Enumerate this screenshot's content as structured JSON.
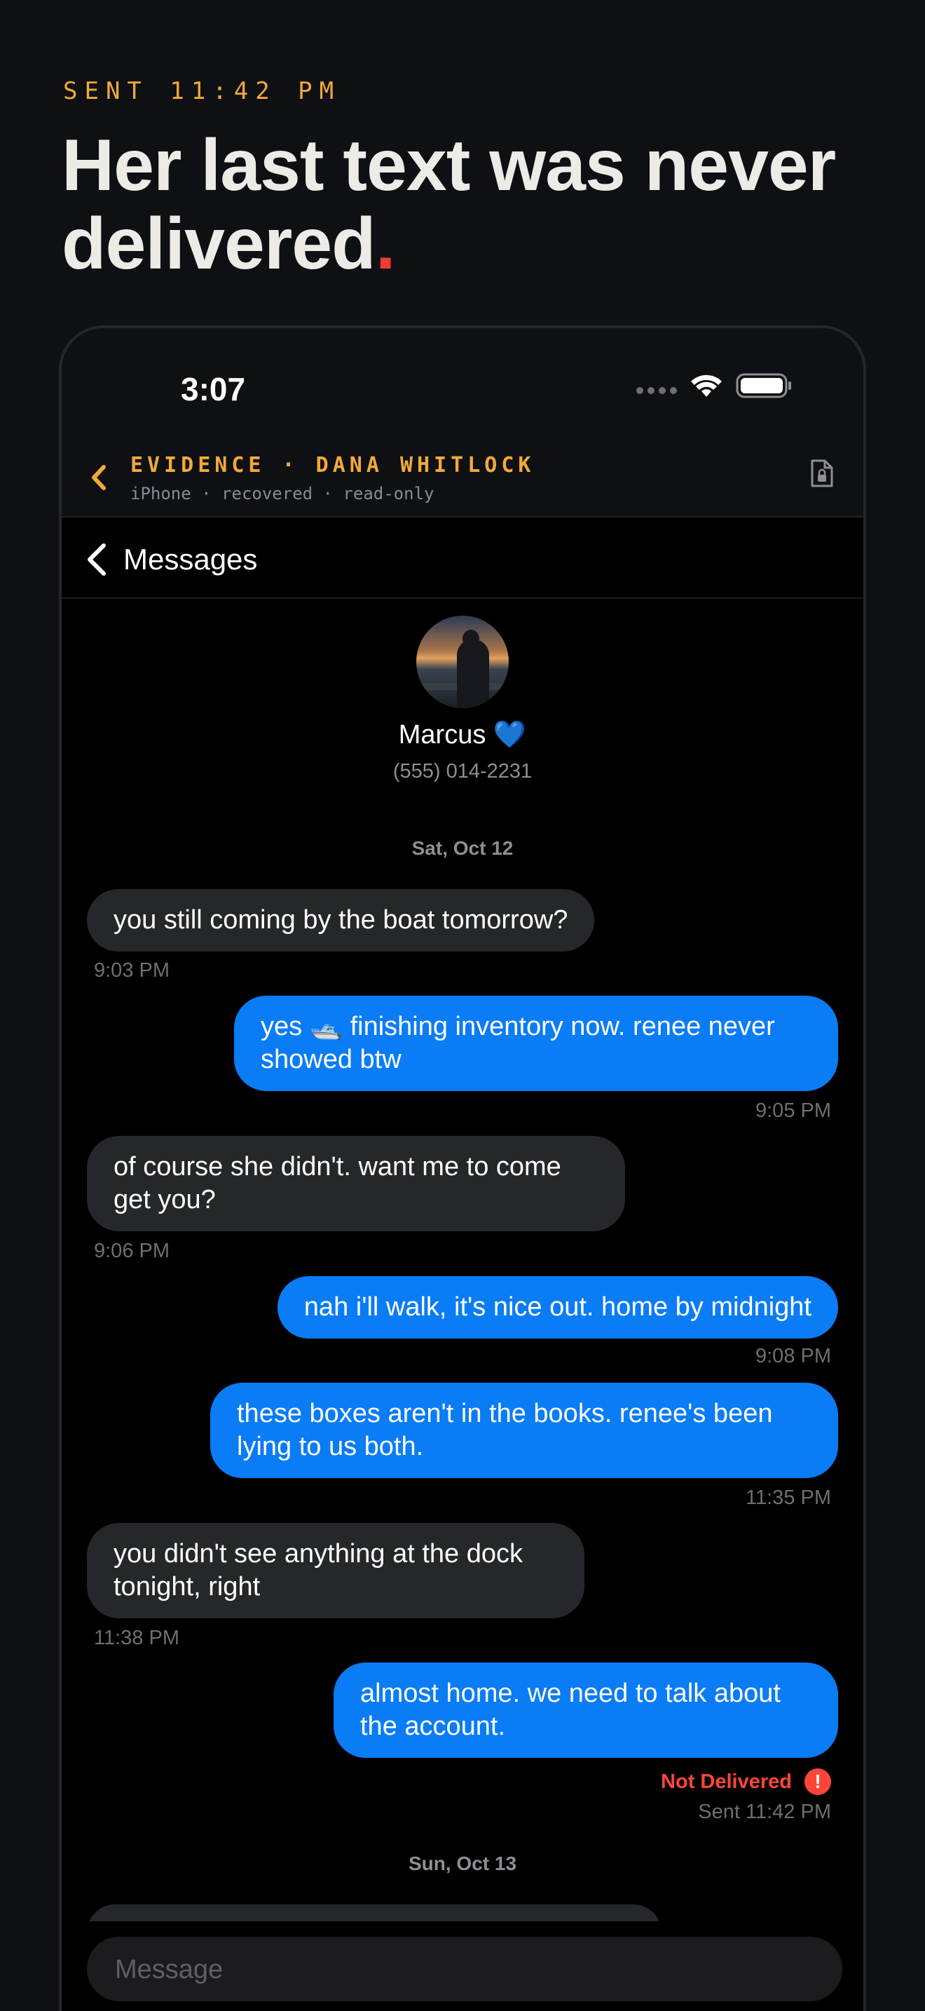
{
  "page": {
    "eyebrow": "SENT 11:42 PM",
    "headline": "Her last text was never delivered",
    "headline_dot": ".",
    "accent_color": "#f2a93b",
    "alert_color": "#ee3b34"
  },
  "status_bar": {
    "time": "3:07",
    "icons": [
      "cellular-signal-icon",
      "wifi-icon",
      "battery-icon"
    ]
  },
  "evidence_bar": {
    "back_icon": "chevron-left-icon",
    "title": "EVIDENCE · DANA WHITLOCK",
    "subtitle": "iPhone · recovered · read-only",
    "doc_icon": "locked-document-icon"
  },
  "nav": {
    "back_icon": "chevron-left-icon",
    "title": "Messages"
  },
  "contact": {
    "name": "Marcus 💙",
    "phone": "(555) 014-2231",
    "avatar_icon": "contact-photo"
  },
  "thread": {
    "date_1": "Sat, Oct 12",
    "messages": [
      {
        "direction": "in",
        "text": "you still coming by the boat tomorrow?",
        "time": "9:03 PM"
      },
      {
        "direction": "out",
        "text": "yes 🛥️ finishing inventory now. renee never showed btw",
        "time": "9:05 PM"
      },
      {
        "direction": "in",
        "text": "of course she didn't. want me to come get you?",
        "time": "9:06 PM"
      },
      {
        "direction": "out",
        "text": "nah i'll walk, it's nice out. home by midnight",
        "time": "9:08 PM"
      },
      {
        "direction": "out",
        "text": "these boxes aren't in the books. renee's been lying to us both.",
        "time": "11:35 PM"
      },
      {
        "direction": "in",
        "text": "you didn't see anything at the dock tonight, right",
        "time": "11:38 PM"
      },
      {
        "direction": "out",
        "text": "almost home. we need to talk about the account.",
        "time": "Sent 11:42 PM"
      }
    ],
    "not_delivered": "Not Delivered",
    "error_glyph": "!",
    "date_2": "Sun, Oct 13"
  },
  "composer": {
    "placeholder": "Message"
  }
}
